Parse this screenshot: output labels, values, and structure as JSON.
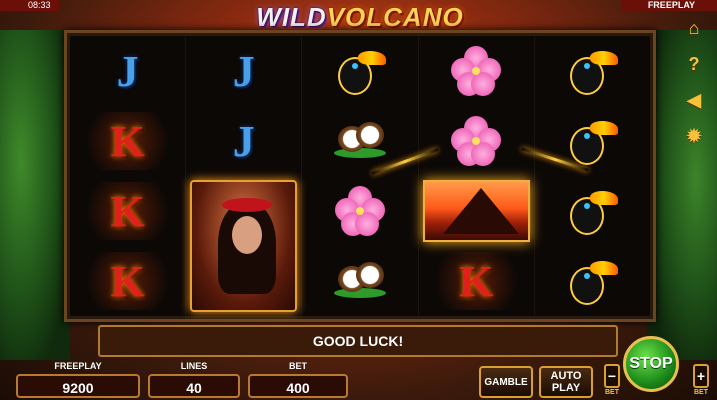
{
  "status": {
    "clock": "08:33",
    "mode": "FREEPLAY"
  },
  "logo": {
    "part1": "WILD",
    "part2": "VOLCANO"
  },
  "reels": [
    [
      "J",
      "K",
      "K",
      "K"
    ],
    [
      "J",
      "J",
      "woman",
      ""
    ],
    [
      "toucan",
      "coconut",
      "flower",
      "coconut"
    ],
    [
      "flower",
      "flower",
      "volcano",
      "K"
    ],
    [
      "toucan",
      "toucan",
      "toucan",
      "toucan"
    ]
  ],
  "message": "GOOD LUCK!",
  "side_menu": [
    "home-icon",
    "help-icon",
    "sound-icon",
    "settings-icon"
  ],
  "bottom": {
    "credit": {
      "label": "FREEPLAY",
      "value": "9200"
    },
    "lines": {
      "label": "LINES",
      "value": "40"
    },
    "bet": {
      "label": "BET",
      "value": "400"
    },
    "gamble_label": "GAMBLE",
    "autoplay_line1": "AUTO",
    "autoplay_line2": "PLAY",
    "stop_label": "STOP",
    "bet_minus": "−",
    "bet_plus": "+",
    "bet_minus_label": "BET",
    "bet_plus_label": "BET"
  },
  "colors": {
    "accent": "#f7c23a",
    "stop": "#1c8a1a",
    "panel_border": "#b87a30"
  }
}
